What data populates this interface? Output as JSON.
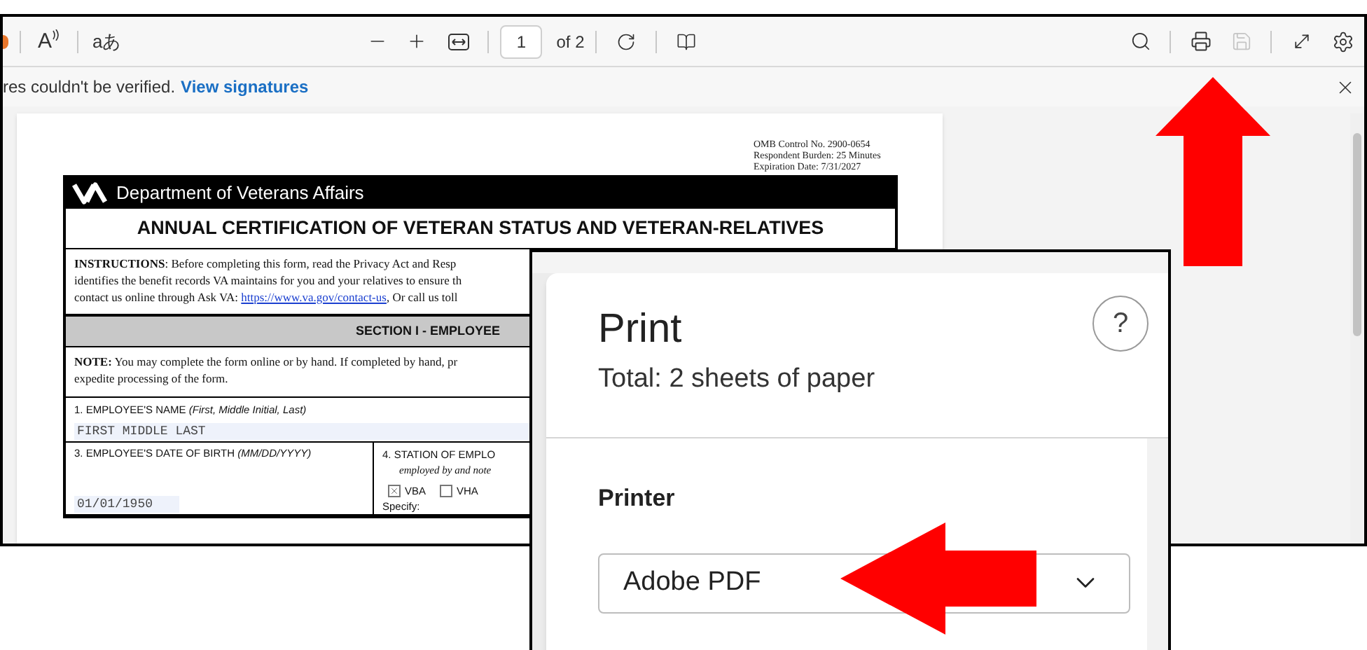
{
  "toolbar": {
    "read_aloud_glyph": "A",
    "translate_glyph": "aあ",
    "page_number": "1",
    "page_count": "of 2",
    "save_disabled": true
  },
  "info_bar": {
    "message": "res couldn't be verified.",
    "link": "View signatures"
  },
  "document": {
    "omb_lines": [
      "OMB Control No. 2900-0654",
      "Respondent Burden:  25 Minutes",
      "Expiration Date:  7/31/2027"
    ],
    "agency": "Department of Veterans Affairs",
    "title": "ANNUAL CERTIFICATION OF VETERAN STATUS AND VETERAN-RELATIVES",
    "instructions": [
      "**INSTRUCTIONS**:  Before completing this form, read the Privacy Act and Resp",
      "identifies the benefit records VA maintains for you and your relatives to ensure th"
    ],
    "contact_prefix": "contact us online through Ask VA: ",
    "contact_link": "https://www.va.gov/contact-us",
    "contact_suffix": ", Or call us toll",
    "section": "SECTION I - EMPLOYEE",
    "note": [
      "**NOTE:**  You may complete the form online or by hand. If completed by hand, pr",
      "expedite processing of the form."
    ],
    "name_label": "1. EMPLOYEE'S NAME *(First, Middle Initial, Last)*",
    "name_value": "FIRST MIDDLE LAST",
    "dob_label": "3. EMPLOYEE'S DATE OF BIRTH *(MM/DD/YYYY)*",
    "dob_value": "01/01/1950",
    "station_label": "4. STATION OF EMPLO",
    "station_hint": "employed by and note",
    "stations": [
      {
        "label": "VBA",
        "checked": true
      },
      {
        "label": "VHA",
        "checked": false
      }
    ],
    "specify_label": "Specify:"
  },
  "print_dialog": {
    "title": "Print",
    "summary": "Total: 2 sheets of paper",
    "help": "?",
    "printer_label": "Printer",
    "printer_value": "Adobe PDF"
  }
}
